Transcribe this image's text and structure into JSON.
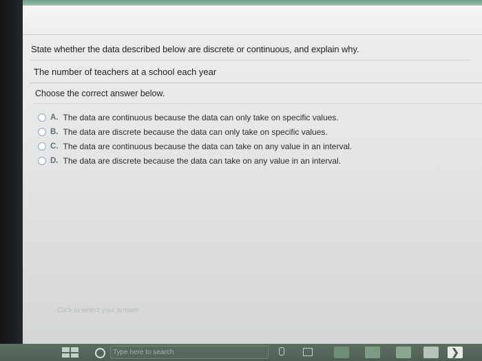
{
  "question": {
    "text": "State whether the data described below are discrete or continuous, and explain why.",
    "prompt": "The number of teachers at a school each year",
    "instruction": "Choose the correct answer below."
  },
  "options": [
    {
      "letter": "A.",
      "text": "The data are continuous because the data can only take on specific values."
    },
    {
      "letter": "B.",
      "text": "The data are discrete because the data can only take on specific values."
    },
    {
      "letter": "C.",
      "text": "The data are continuous because the data can take on any value in an interval."
    },
    {
      "letter": "D.",
      "text": "The data are discrete because the data can take on any value in an interval."
    }
  ],
  "answer_hint": "Click to select your answer",
  "taskbar": {
    "search_placeholder": "Type here to search",
    "icons": [
      "windows-start-icon",
      "search-icon",
      "microphone-icon",
      "task-view-icon",
      "app-icon",
      "app-icon",
      "app-icon",
      "app-icon",
      "app-icon"
    ]
  },
  "colors": {
    "top_accent": "#6f9d88",
    "radio_border": "#8faec1",
    "taskbar": "#4e5e52"
  }
}
